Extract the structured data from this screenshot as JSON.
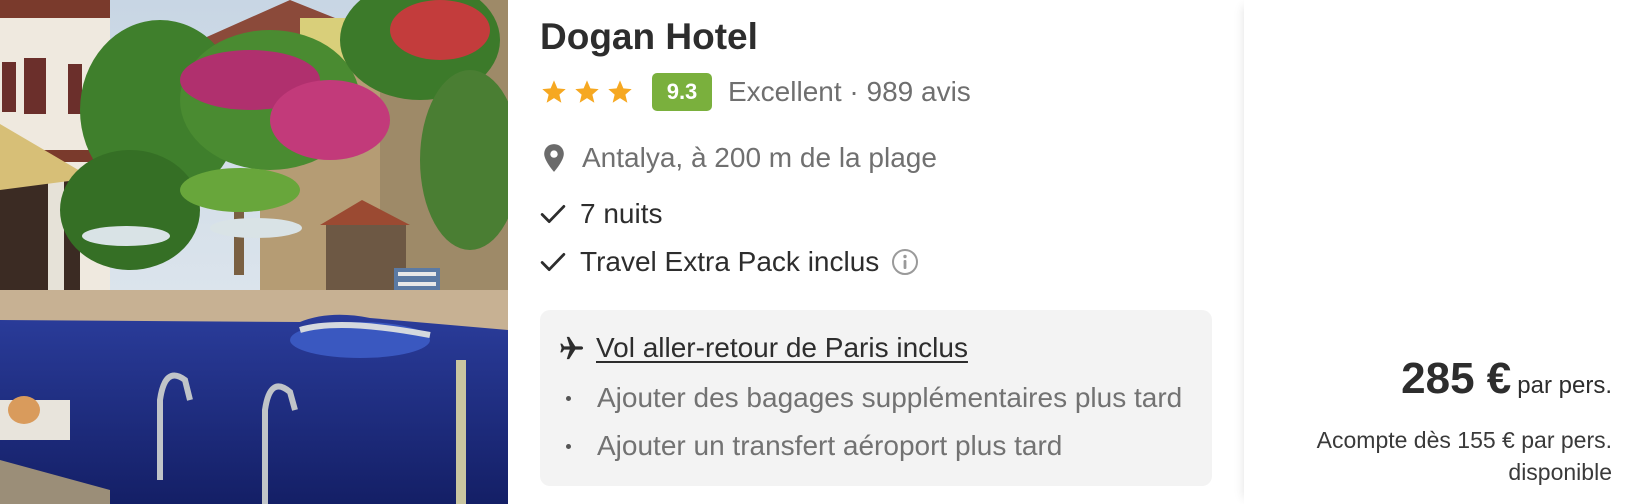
{
  "hotel": {
    "name": "Dogan Hotel",
    "star_count": 3,
    "star_color": "#f6a821",
    "score": "9.3",
    "score_color": "#7ab03d",
    "rating_text": "Excellent · 989 avis",
    "location": "Antalya, à 200 m de la plage",
    "features": [
      "7 nuits",
      "Travel Extra Pack inclus"
    ]
  },
  "flight": {
    "label": "Vol aller-retour de Paris inclus",
    "extras": [
      "Ajouter des bagages supplémentaires plus tard",
      "Ajouter un transfert aéroport plus tard"
    ]
  },
  "pricing": {
    "price": "285 €",
    "per_person": "par pers.",
    "deposit": "Acompte dès 155 € par pers. disponible"
  },
  "icons": {
    "star": "star-icon",
    "location": "map-pin-icon",
    "check": "check-icon",
    "info": "info-icon",
    "plane": "plane-icon"
  }
}
